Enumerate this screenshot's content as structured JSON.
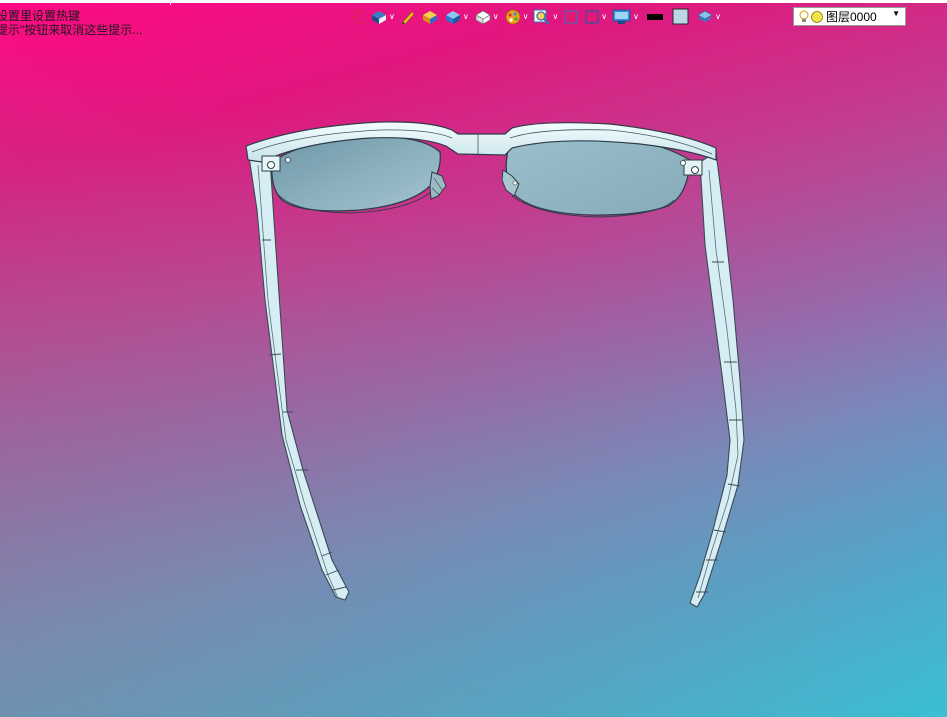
{
  "hint": {
    "line1": "设置里设置热键",
    "line2": "提示\"按钮来取消这些提示..."
  },
  "toolbar": {
    "buttons": [
      {
        "name": "exit-sketch-icon",
        "has_caret": false
      },
      {
        "name": "view-orientation-icon",
        "has_caret": true
      },
      {
        "name": "pencil-icon",
        "has_caret": false
      },
      {
        "name": "render-icon",
        "has_caret": false
      },
      {
        "name": "display-style-icon",
        "has_caret": true
      },
      {
        "name": "box-view-icon",
        "has_caret": true
      },
      {
        "name": "appearance-icon",
        "has_caret": true
      },
      {
        "name": "zoom-icon",
        "has_caret": true
      },
      {
        "name": "zoom-fit-icon",
        "has_caret": false
      },
      {
        "name": "section-view-icon",
        "has_caret": true
      },
      {
        "name": "monitor-icon",
        "has_caret": true
      },
      {
        "name": "line-color-icon",
        "has_caret": false
      },
      {
        "name": "fill-color-icon",
        "has_caret": false
      },
      {
        "name": "layers-icon",
        "has_caret": true
      }
    ],
    "colors": {
      "line_color": "#000000",
      "fill_color": "#bcd8e8"
    }
  },
  "layer": {
    "current": "图层0000",
    "lamp_color": "#f2e34a"
  },
  "model": {
    "name": "glasses-model",
    "frame_color": "#d8f0f4",
    "lens_color": "#8fb8c6"
  }
}
